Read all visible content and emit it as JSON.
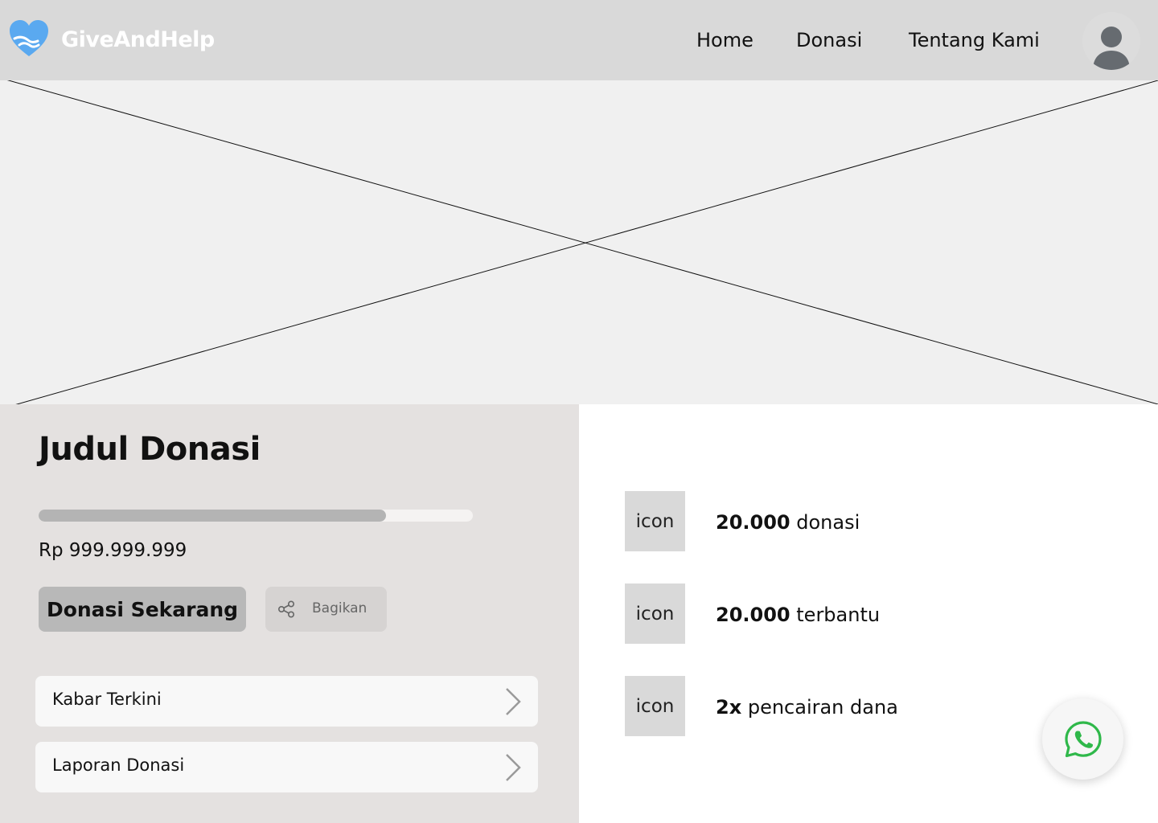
{
  "header": {
    "brand": "GiveAndHelp",
    "nav": [
      "Home",
      "Donasi",
      "Tentang Kami"
    ],
    "colors": {
      "background": "#d9d9d9",
      "logo": "#5aa9f0"
    }
  },
  "hero": {
    "image": "placeholder"
  },
  "campaign": {
    "title": "Judul Donasi",
    "progress": 0.8,
    "amount": "Rp 999.999.999",
    "donate_label": "Donasi Sekarang",
    "share_label": "Bagikan",
    "items": [
      "Kabar Terkini",
      "Laporan Donasi"
    ]
  },
  "stats": [
    {
      "icon": "icon",
      "value": "20.000",
      "label": "donasi"
    },
    {
      "icon": "icon",
      "value": "20.000",
      "label": "terbantu"
    },
    {
      "icon": "icon",
      "value": "2x",
      "label": "pencairan dana"
    }
  ],
  "fab": {
    "icon": "whatsapp-icon",
    "color": "#2fb84a"
  }
}
